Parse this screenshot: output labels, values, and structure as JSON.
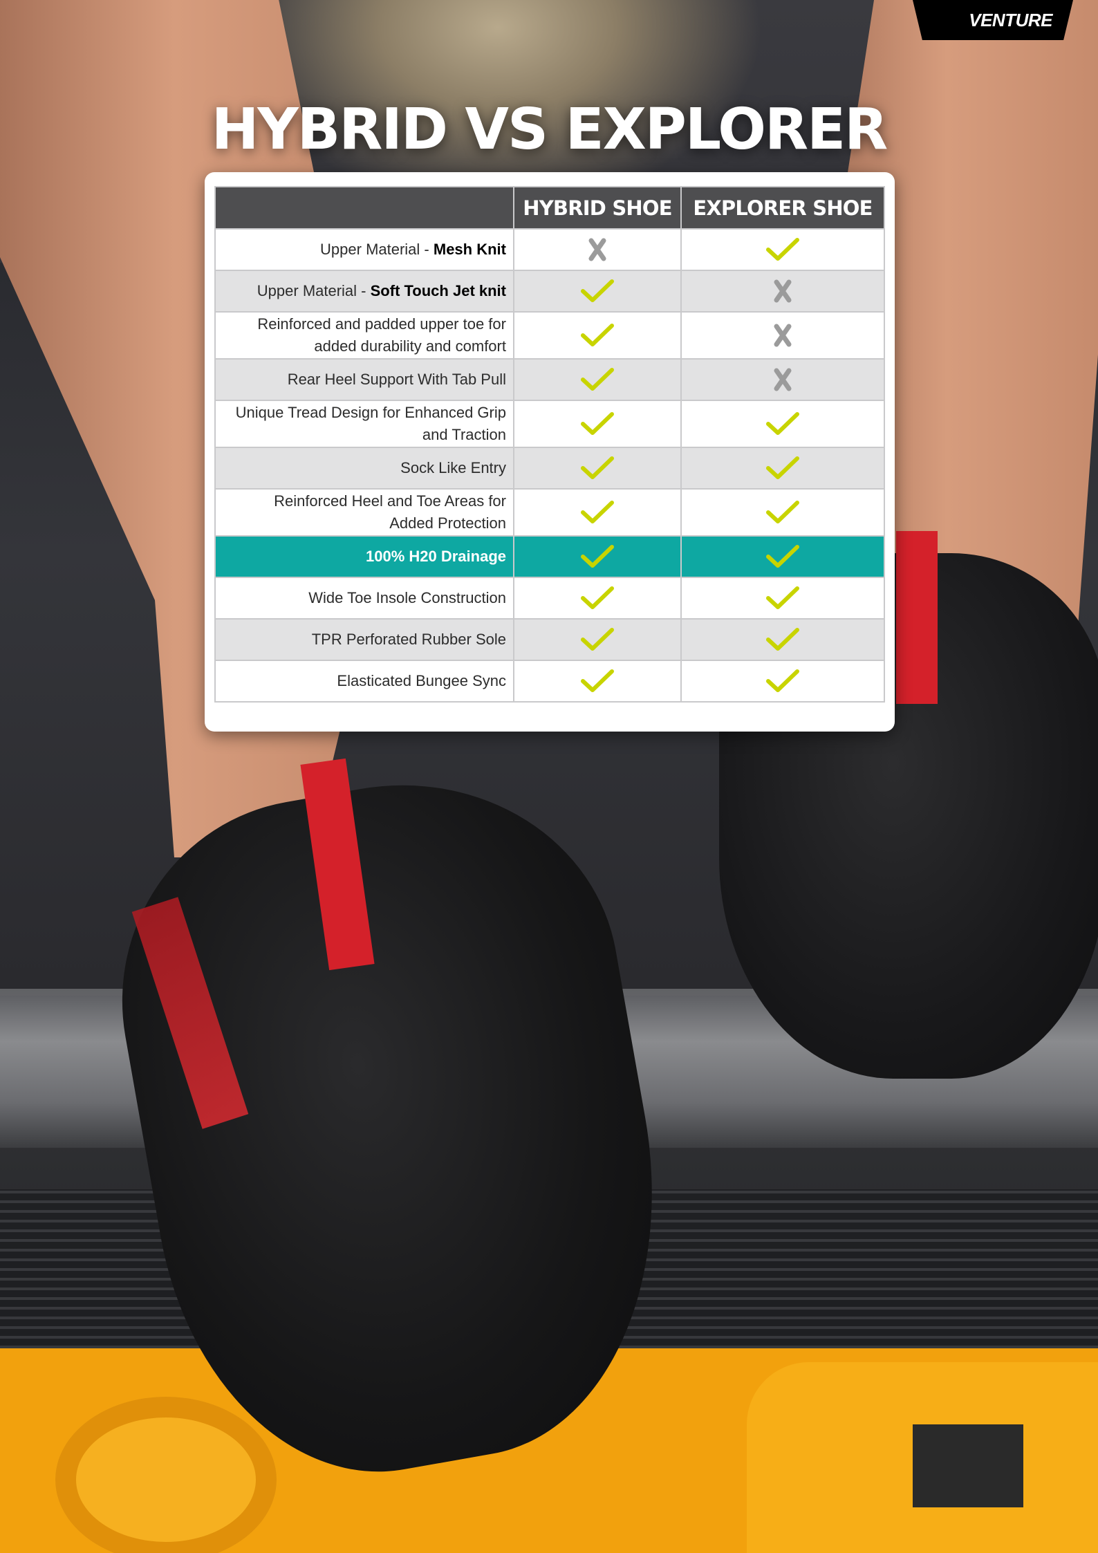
{
  "brand": {
    "logo_text": "VENTURE"
  },
  "title": "HYBRID VS EXPLORER",
  "table": {
    "columns": [
      "",
      "HYBRID SHOE",
      "EXPLORER SHOE"
    ],
    "rows": [
      {
        "feature": "Upper Material - ",
        "feature_bold": "Mesh Knit",
        "feature_line2": "",
        "hybrid": "cross",
        "explorer": "check",
        "highlight": false
      },
      {
        "feature": "Upper Material - ",
        "feature_bold": "Soft Touch Jet knit",
        "feature_line2": "",
        "hybrid": "check",
        "explorer": "cross",
        "highlight": false
      },
      {
        "feature": "Reinforced and padded upper toe for",
        "feature_bold": "",
        "feature_line2": "added durability and comfort",
        "hybrid": "check",
        "explorer": "cross",
        "highlight": false
      },
      {
        "feature": "Rear Heel Support With Tab Pull",
        "feature_bold": "",
        "feature_line2": "",
        "hybrid": "check",
        "explorer": "cross",
        "highlight": false
      },
      {
        "feature": "Unique Tread Design for Enhanced Grip",
        "feature_bold": "",
        "feature_line2": "and Traction",
        "hybrid": "check",
        "explorer": "check",
        "highlight": false
      },
      {
        "feature": "Sock Like Entry",
        "feature_bold": "",
        "feature_line2": "",
        "hybrid": "check",
        "explorer": "check",
        "highlight": false
      },
      {
        "feature": "Reinforced Heel and Toe Areas for",
        "feature_bold": "",
        "feature_line2": "Added Protection",
        "hybrid": "check",
        "explorer": "check",
        "highlight": false
      },
      {
        "feature": "100% H20 Drainage",
        "feature_bold": "",
        "feature_line2": "",
        "hybrid": "check",
        "explorer": "check",
        "highlight": true
      },
      {
        "feature": "Wide Toe Insole Construction",
        "feature_bold": "",
        "feature_line2": "",
        "hybrid": "check",
        "explorer": "check",
        "highlight": false
      },
      {
        "feature": "TPR Perforated Rubber Sole",
        "feature_bold": "",
        "feature_line2": "",
        "hybrid": "check",
        "explorer": "check",
        "highlight": false
      },
      {
        "feature": "Elasticated Bungee Sync",
        "feature_bold": "",
        "feature_line2": "",
        "hybrid": "check",
        "explorer": "check",
        "highlight": false
      }
    ]
  },
  "colors": {
    "check": "#c8d400",
    "cross": "#9b9b9b",
    "highlight": "#0ea8a2",
    "header": "#4e4e50",
    "hull": "#f2a10d"
  }
}
